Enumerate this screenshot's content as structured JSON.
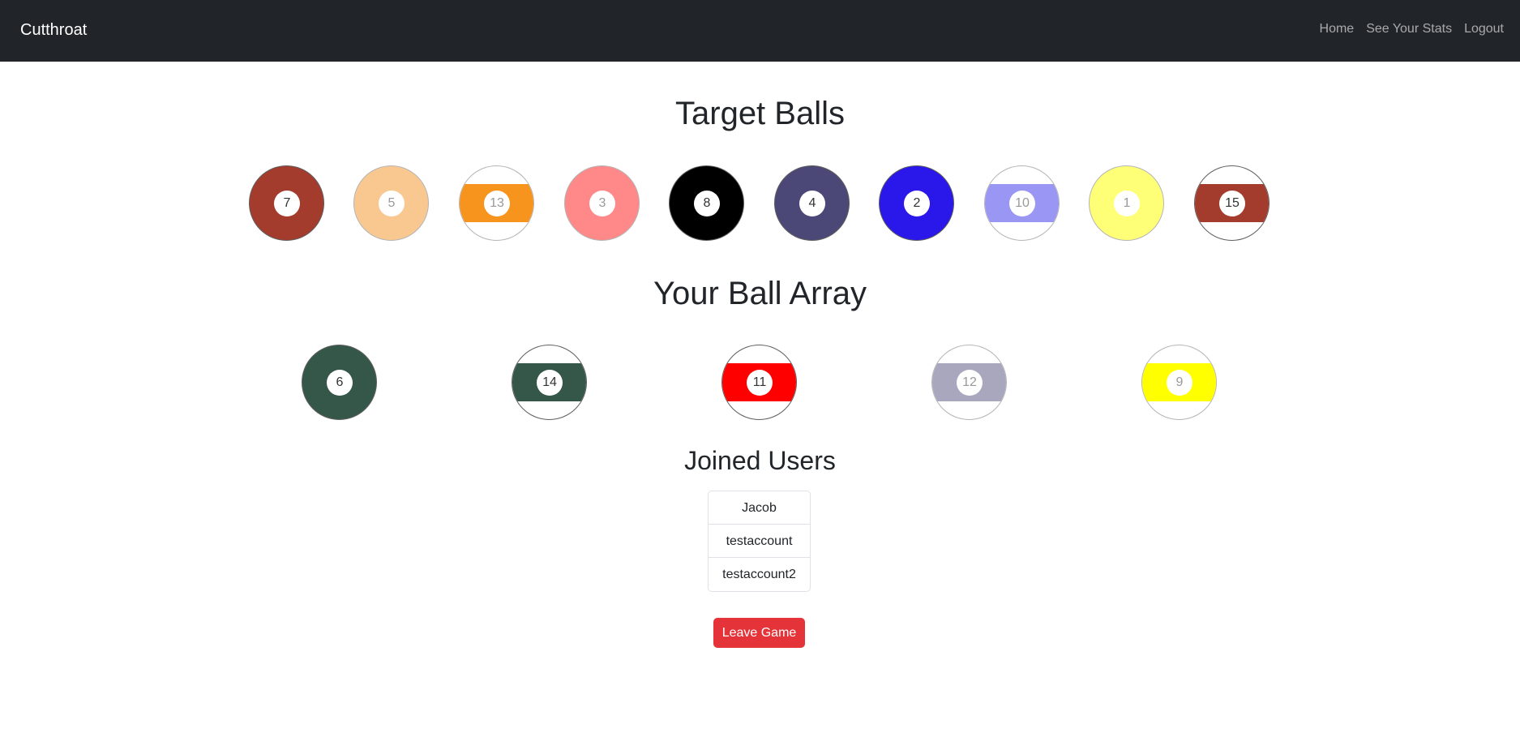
{
  "navbar": {
    "brand": "Cutthroat",
    "links": [
      "Home",
      "See Your Stats",
      "Logout"
    ]
  },
  "target_section": {
    "title": "Target Balls",
    "balls": [
      {
        "number": "7",
        "color": "#a33c2d",
        "striped": false
      },
      {
        "number": "5",
        "color": "#f8c890",
        "striped": false
      },
      {
        "number": "13",
        "color": "#f7941d",
        "striped": true
      },
      {
        "number": "3",
        "color": "#ff8888",
        "striped": false
      },
      {
        "number": "8",
        "color": "#000000",
        "striped": false
      },
      {
        "number": "4",
        "color": "#4b4878",
        "striped": false
      },
      {
        "number": "2",
        "color": "#2a17ea",
        "striped": false
      },
      {
        "number": "10",
        "color": "#9a96f4",
        "striped": true
      },
      {
        "number": "1",
        "color": "#ffff77",
        "striped": false
      },
      {
        "number": "15",
        "color": "#a33c2d",
        "striped": true
      }
    ]
  },
  "array_section": {
    "title": "Your Ball Array",
    "balls": [
      {
        "number": "6",
        "color": "#35574a",
        "striped": false
      },
      {
        "number": "14",
        "color": "#35574a",
        "striped": true
      },
      {
        "number": "11",
        "color": "#ff0000",
        "striped": true
      },
      {
        "number": "12",
        "color": "#a9a7bd",
        "striped": true
      },
      {
        "number": "9",
        "color": "#ffff00",
        "striped": true
      }
    ]
  },
  "users_section": {
    "title": "Joined Users",
    "users": [
      "Jacob",
      "testaccount",
      "testaccount2"
    ]
  },
  "actions": {
    "leave_label": "Leave Game"
  }
}
